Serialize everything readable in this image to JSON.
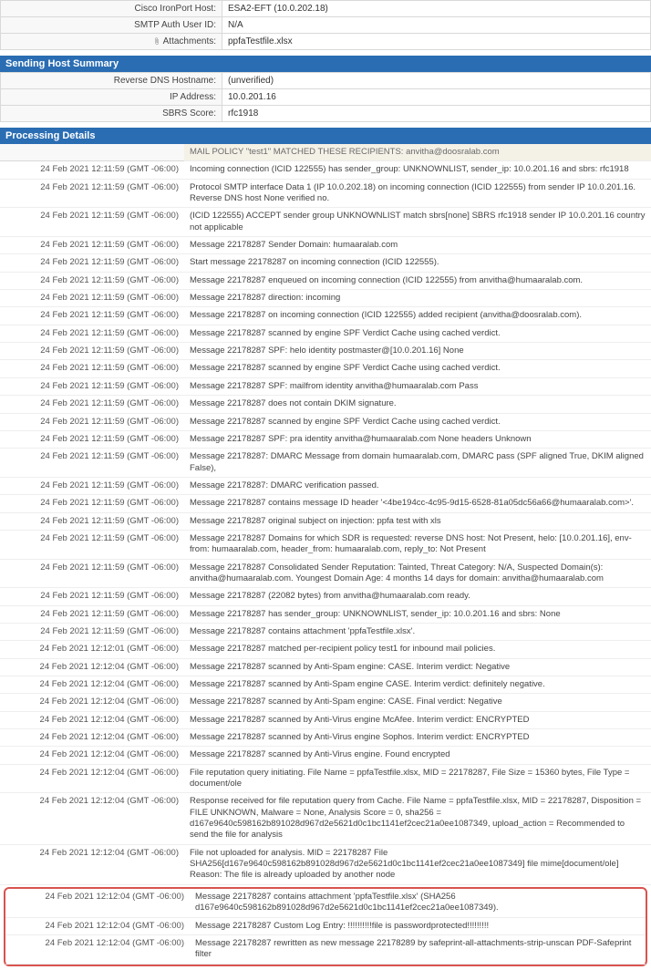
{
  "top_fields": [
    {
      "label": "Cisco IronPort Host:",
      "value": "ESA2-EFT (10.0.202.18)"
    },
    {
      "label": "SMTP Auth User ID:",
      "value": "N/A"
    },
    {
      "label": "Attachments:",
      "value": "ppfaTestfile.xlsx",
      "icon": true
    }
  ],
  "sending_host_header": "Sending Host Summary",
  "sending_host_fields": [
    {
      "label": "Reverse DNS Hostname:",
      "value": "(unverified)"
    },
    {
      "label": "IP Address:",
      "value": "10.0.201.16"
    },
    {
      "label": "SBRS Score:",
      "value": "rfc1918"
    }
  ],
  "processing_header": "Processing Details",
  "policy_banner": "MAIL POLICY \"test1\" MATCHED THESE RECIPIENTS: anvitha@doosralab.com",
  "log": [
    {
      "ts": "24 Feb 2021 12:11:59 (GMT -06:00)",
      "msg": "Incoming connection (ICID 122555) has sender_group: UNKNOWNLIST, sender_ip: 10.0.201.16 and sbrs: rfc1918"
    },
    {
      "ts": "24 Feb 2021 12:11:59 (GMT -06:00)",
      "msg": "Protocol SMTP interface Data 1 (IP 10.0.202.18) on incoming connection (ICID 122555) from sender IP 10.0.201.16. Reverse DNS host None verified no."
    },
    {
      "ts": "24 Feb 2021 12:11:59 (GMT -06:00)",
      "msg": "(ICID 122555) ACCEPT sender group UNKNOWNLIST match sbrs[none] SBRS rfc1918 sender IP 10.0.201.16 country not applicable"
    },
    {
      "ts": "24 Feb 2021 12:11:59 (GMT -06:00)",
      "msg": "Message 22178287 Sender Domain: humaaralab.com"
    },
    {
      "ts": "24 Feb 2021 12:11:59 (GMT -06:00)",
      "msg": "Start message 22178287 on incoming connection (ICID 122555)."
    },
    {
      "ts": "24 Feb 2021 12:11:59 (GMT -06:00)",
      "msg": "Message 22178287 enqueued on incoming connection (ICID 122555) from anvitha@humaaralab.com."
    },
    {
      "ts": "24 Feb 2021 12:11:59 (GMT -06:00)",
      "msg": "Message 22178287 direction: incoming"
    },
    {
      "ts": "24 Feb 2021 12:11:59 (GMT -06:00)",
      "msg": "Message 22178287 on incoming connection (ICID 122555) added recipient (anvitha@doosralab.com)."
    },
    {
      "ts": "24 Feb 2021 12:11:59 (GMT -06:00)",
      "msg": "Message 22178287 scanned by engine SPF Verdict Cache using cached verdict."
    },
    {
      "ts": "24 Feb 2021 12:11:59 (GMT -06:00)",
      "msg": "Message 22178287 SPF: helo identity postmaster@[10.0.201.16] None"
    },
    {
      "ts": "24 Feb 2021 12:11:59 (GMT -06:00)",
      "msg": "Message 22178287 scanned by engine SPF Verdict Cache using cached verdict."
    },
    {
      "ts": "24 Feb 2021 12:11:59 (GMT -06:00)",
      "msg": "Message 22178287 SPF: mailfrom identity anvitha@humaaralab.com Pass"
    },
    {
      "ts": "24 Feb 2021 12:11:59 (GMT -06:00)",
      "msg": "Message 22178287 does not contain DKIM signature."
    },
    {
      "ts": "24 Feb 2021 12:11:59 (GMT -06:00)",
      "msg": "Message 22178287 scanned by engine SPF Verdict Cache using cached verdict."
    },
    {
      "ts": "24 Feb 2021 12:11:59 (GMT -06:00)",
      "msg": "Message 22178287 SPF: pra identity anvitha@humaaralab.com None headers Unknown"
    },
    {
      "ts": "24 Feb 2021 12:11:59 (GMT -06:00)",
      "msg": "Message 22178287: DMARC Message from domain humaaralab.com, DMARC pass (SPF aligned True, DKIM aligned False),"
    },
    {
      "ts": "24 Feb 2021 12:11:59 (GMT -06:00)",
      "msg": "Message 22178287: DMARC verification passed."
    },
    {
      "ts": "24 Feb 2021 12:11:59 (GMT -06:00)",
      "msg": "Message 22178287 contains message ID header '<4be194cc-4c95-9d15-6528-81a05dc56a66@humaaralab.com>'."
    },
    {
      "ts": "24 Feb 2021 12:11:59 (GMT -06:00)",
      "msg": "Message 22178287 original subject on injection: ppfa test with xls"
    },
    {
      "ts": "24 Feb 2021 12:11:59 (GMT -06:00)",
      "msg": "Message 22178287 Domains for which SDR is requested: reverse DNS host: Not Present, helo: [10.0.201.16], env-from: humaaralab.com, header_from: humaaralab.com, reply_to: Not Present"
    },
    {
      "ts": "24 Feb 2021 12:11:59 (GMT -06:00)",
      "msg": "Message 22178287 Consolidated Sender Reputation: Tainted, Threat Category: N/A, Suspected Domain(s): anvitha@humaaralab.com. Youngest Domain Age: 4 months 14 days for domain: anvitha@humaaralab.com"
    },
    {
      "ts": "24 Feb 2021 12:11:59 (GMT -06:00)",
      "msg": "Message 22178287 (22082 bytes) from anvitha@humaaralab.com ready."
    },
    {
      "ts": "24 Feb 2021 12:11:59 (GMT -06:00)",
      "msg": "Message 22178287 has sender_group: UNKNOWNLIST, sender_ip: 10.0.201.16 and sbrs: None"
    },
    {
      "ts": "24 Feb 2021 12:11:59 (GMT -06:00)",
      "msg": "Message 22178287 contains attachment 'ppfaTestfile.xlsx'."
    },
    {
      "ts": "24 Feb 2021 12:12:01 (GMT -06:00)",
      "msg": "Message 22178287 matched per-recipient policy test1 for inbound mail policies."
    },
    {
      "ts": "24 Feb 2021 12:12:04 (GMT -06:00)",
      "msg": "Message 22178287 scanned by Anti-Spam engine: CASE. Interim verdict: Negative"
    },
    {
      "ts": "24 Feb 2021 12:12:04 (GMT -06:00)",
      "msg": "Message 22178287 scanned by Anti-Spam engine CASE. Interim verdict: definitely negative."
    },
    {
      "ts": "24 Feb 2021 12:12:04 (GMT -06:00)",
      "msg": "Message 22178287 scanned by Anti-Spam engine: CASE. Final verdict: Negative"
    },
    {
      "ts": "24 Feb 2021 12:12:04 (GMT -06:00)",
      "msg": "Message 22178287 scanned by Anti-Virus engine McAfee. Interim verdict: ENCRYPTED"
    },
    {
      "ts": "24 Feb 2021 12:12:04 (GMT -06:00)",
      "msg": "Message 22178287 scanned by Anti-Virus engine Sophos. Interim verdict: ENCRYPTED"
    },
    {
      "ts": "24 Feb 2021 12:12:04 (GMT -06:00)",
      "msg": "Message 22178287 scanned by Anti-Virus engine. Found encrypted"
    },
    {
      "ts": "24 Feb 2021 12:12:04 (GMT -06:00)",
      "msg": "File reputation query initiating. File Name = ppfaTestfile.xlsx, MID = 22178287, File Size = 15360 bytes, File Type = document/ole"
    },
    {
      "ts": "24 Feb 2021 12:12:04 (GMT -06:00)",
      "msg": "Response received for file reputation query from Cache. File Name = ppfaTestfile.xlsx, MID = 22178287, Disposition = FILE UNKNOWN, Malware = None, Analysis Score = 0, sha256 = d167e9640c598162b891028d967d2e5621d0c1bc1141ef2cec21a0ee1087349, upload_action = Recommended to send the file for analysis"
    },
    {
      "ts": "24 Feb 2021 12:12:04 (GMT -06:00)",
      "msg": "File not uploaded for analysis. MID = 22178287 File SHA256[d167e9640c598162b891028d967d2e5621d0c1bc1141ef2cec21a0ee1087349] file mime[document/ole] Reason: The file is already uploaded by another node"
    }
  ],
  "highlight_log": [
    {
      "ts": "24 Feb 2021 12:12:04 (GMT -06:00)",
      "msg": "Message 22178287 contains attachment 'ppfaTestfile.xlsx' (SHA256 d167e9640c598162b891028d967d2e5621d0c1bc1141ef2cec21a0ee1087349)."
    },
    {
      "ts": "24 Feb 2021 12:12:04 (GMT -06:00)",
      "msg": "Message 22178287 Custom Log Entry: !!!!!!!!!!file is passwordprotected!!!!!!!!!"
    },
    {
      "ts": "24 Feb 2021 12:12:04 (GMT -06:00)",
      "msg": "Message 22178287 rewritten as new message 22178289 by safeprint-all-attachments-strip-unscan PDF-Safeprint filter"
    }
  ]
}
